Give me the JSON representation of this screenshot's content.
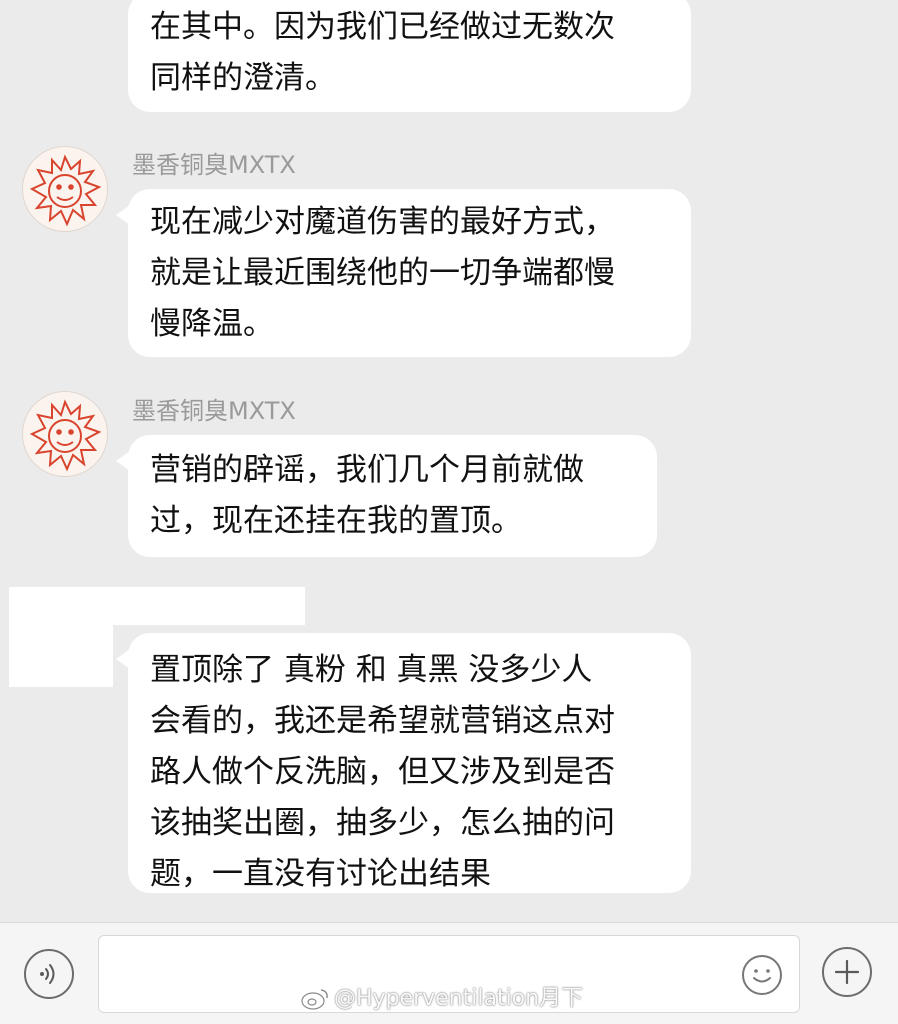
{
  "messages": [
    {
      "text": "在其中。因为我们已经做过无数次\n同样的澄清。"
    },
    {
      "sender": "墨香铜臭MXTX",
      "text": "现在减少对魔道伤害的最好方式，\n就是让最近围绕他的一切争端都慢\n慢降温。"
    },
    {
      "sender": "墨香铜臭MXTX",
      "text": "营销的辟谣，我们几个月前就做\n过，现在还挂在我的置顶。"
    },
    {
      "text": "置顶除了 真粉 和 真黑 没多少人\n会看的，我还是希望就营销这点对\n路人做个反洗脑，但又涉及到是否\n该抽奖出圈，抽多少，怎么抽的问\n题，一直没有讨论出结果"
    }
  ],
  "input_bar": {
    "voice_icon": "voice-icon",
    "emoji_icon": "smiley-icon",
    "add_icon": "plus-icon",
    "input_value": ""
  },
  "watermark": {
    "icon": "weibo-logo-icon",
    "text": "@Hyperventilation月下"
  },
  "colors": {
    "background": "#ebebeb",
    "bubble": "#ffffff",
    "sender_name": "#9a9a9a",
    "avatar_red": "#d9442e"
  }
}
